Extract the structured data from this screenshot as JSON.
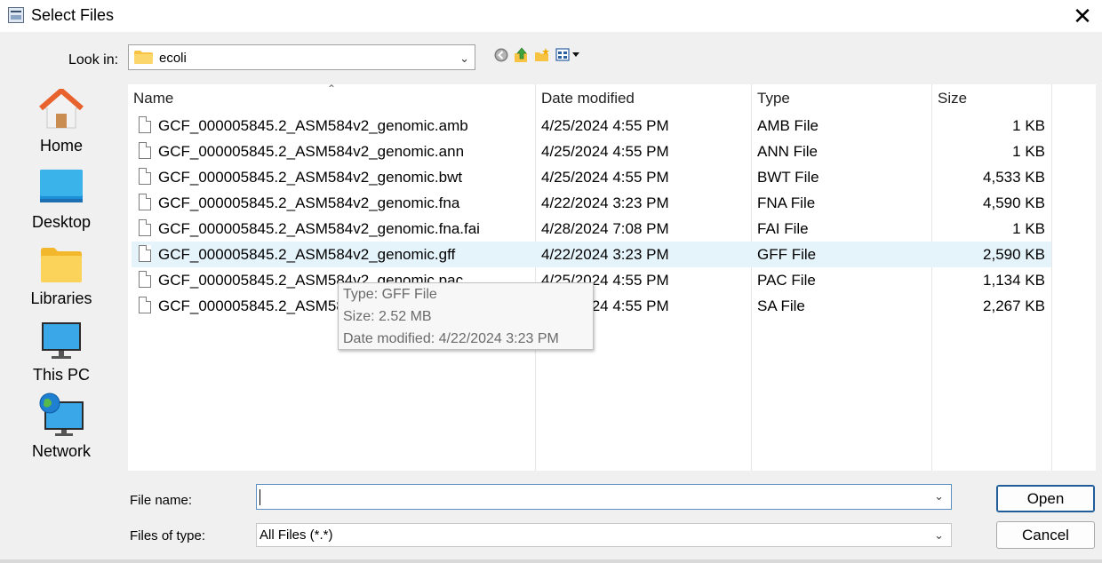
{
  "window": {
    "title": "Select Files",
    "close_glyph": "✕"
  },
  "lookin": {
    "label": "Look in:",
    "value": "ecoli"
  },
  "toolbar": {
    "icons": [
      "back-icon",
      "up-folder-icon",
      "new-folder-icon",
      "view-menu-icon"
    ]
  },
  "places": [
    {
      "label": "Home",
      "icon": "home-icon"
    },
    {
      "label": "Desktop",
      "icon": "desktop-icon"
    },
    {
      "label": "Libraries",
      "icon": "libraries-icon"
    },
    {
      "label": "This PC",
      "icon": "this-pc-icon"
    },
    {
      "label": "Network",
      "icon": "network-icon"
    }
  ],
  "columns": {
    "name": "Name",
    "date": "Date modified",
    "type": "Type",
    "size": "Size"
  },
  "files": [
    {
      "name": "GCF_000005845.2_ASM584v2_genomic.amb",
      "date": "4/25/2024 4:55 PM",
      "type": "AMB File",
      "size": "1 KB"
    },
    {
      "name": "GCF_000005845.2_ASM584v2_genomic.ann",
      "date": "4/25/2024 4:55 PM",
      "type": "ANN File",
      "size": "1 KB"
    },
    {
      "name": "GCF_000005845.2_ASM584v2_genomic.bwt",
      "date": "4/25/2024 4:55 PM",
      "type": "BWT File",
      "size": "4,533 KB"
    },
    {
      "name": "GCF_000005845.2_ASM584v2_genomic.fna",
      "date": "4/22/2024 3:23 PM",
      "type": "FNA File",
      "size": "4,590 KB"
    },
    {
      "name": "GCF_000005845.2_ASM584v2_genomic.fna.fai",
      "date": "4/28/2024 7:08 PM",
      "type": "FAI File",
      "size": "1 KB"
    },
    {
      "name": "GCF_000005845.2_ASM584v2_genomic.gff",
      "date": "4/22/2024 3:23 PM",
      "type": "GFF File",
      "size": "2,590 KB"
    },
    {
      "name": "GCF_000005845.2_ASM584v2_genomic.pac",
      "date": "4/25/2024 4:55 PM",
      "type": "PAC File",
      "size": "1,134 KB"
    },
    {
      "name": "GCF_000005845.2_ASM584v2_genomic.sa",
      "date": "4/25/2024 4:55 PM",
      "type": "SA File",
      "size": "2,267 KB"
    }
  ],
  "tooltip": {
    "type_line": "Type: GFF File",
    "size_line": "Size: 2.52 MB",
    "date_line": "Date modified: 4/22/2024 3:23 PM"
  },
  "filename": {
    "label": "File name:",
    "value": ""
  },
  "filetype": {
    "label": "Files of type:",
    "value": "All Files (*.*)"
  },
  "buttons": {
    "open": "Open",
    "cancel": "Cancel"
  },
  "colors": {
    "selection": "#e5f3fb",
    "accent": "#1f5c99",
    "folder": "#f6c342"
  }
}
